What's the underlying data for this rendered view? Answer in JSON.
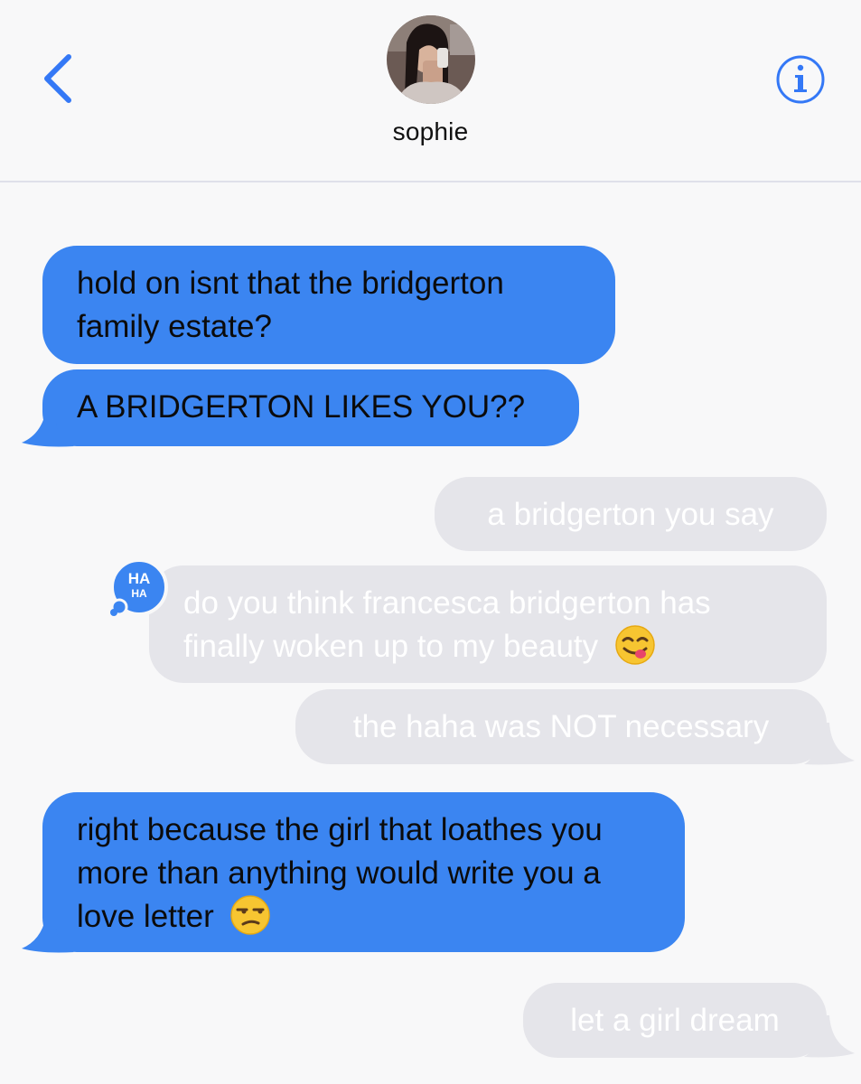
{
  "header": {
    "contact_name": "sophie",
    "back_icon": "chevron-left-icon",
    "info_icon": "info-circle-icon",
    "accent_color": "#3478f6"
  },
  "messages": [
    {
      "direction": "incoming",
      "text": "hold on isnt that the bridgerton family estate?"
    },
    {
      "direction": "incoming",
      "text": "A BRIDGERTON LIKES YOU??"
    },
    {
      "direction": "outgoing",
      "text": "a bridgerton you say"
    },
    {
      "direction": "outgoing",
      "text": "do you think francesca bridgerton has finally woken up to my beauty",
      "emoji": "face-savoring-food",
      "reaction": "HA HA"
    },
    {
      "direction": "outgoing",
      "text": "the haha was NOT necessary"
    },
    {
      "direction": "incoming",
      "text": "right because the girl that loathes you more than anything would write you a love letter",
      "emoji": "unamused-face"
    },
    {
      "direction": "outgoing",
      "text": "let a girl dream"
    }
  ],
  "colors": {
    "incoming_bubble": "#3b85f1",
    "outgoing_bubble": "#e5e5ea",
    "background": "#f8f8f9"
  }
}
